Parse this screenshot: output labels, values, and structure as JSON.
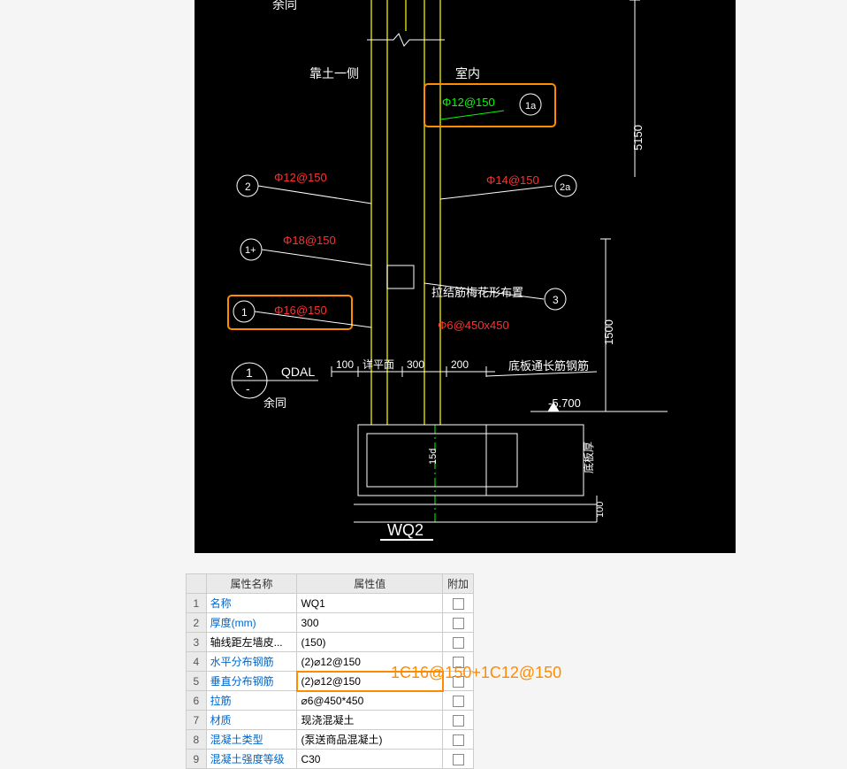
{
  "cad": {
    "title": "WQ2",
    "labels": {
      "outside": "靠土一侧",
      "inside": "室内",
      "tie_note": "拉结筋梅花形布置",
      "detail_plane": "详平面",
      "bottom_rebar": "底板通长筋钢筋",
      "ref_same": "余同",
      "thick_label": "底板厚",
      "ref_code": "QDAL"
    },
    "rebar": {
      "r12_150_top": "Φ12@150",
      "r12_150_left": "Φ12@150",
      "r14_150": "Φ14@150",
      "r18_150": "Φ18@150",
      "r16_150": "Φ16@150",
      "r6_450": "Φ6@450x450"
    },
    "dims": {
      "d5150": "5150",
      "d1500": "1500",
      "d100a": "100",
      "d300": "300",
      "d200": "200",
      "d100b": "100",
      "d15d": "15d",
      "elev": "-5.700"
    },
    "bubbles": {
      "b1": "1",
      "b1a": "1a",
      "b1plus": "1+",
      "b2": "2",
      "b2a": "2a",
      "b3": "3",
      "sec": "1"
    }
  },
  "table": {
    "header": {
      "name": "属性名称",
      "value": "属性值",
      "extra": "附加"
    },
    "rows": [
      {
        "n": "1",
        "name": "名称",
        "value": "WQ1",
        "link": true
      },
      {
        "n": "2",
        "name": "厚度(mm)",
        "value": "300",
        "link": true
      },
      {
        "n": "3",
        "name": "轴线距左墙皮...",
        "value": "(150)",
        "link": false
      },
      {
        "n": "4",
        "name": "水平分布钢筋",
        "value": "(2)⌀12@150",
        "link": true
      },
      {
        "n": "5",
        "name": "垂直分布钢筋",
        "value": "(2)⌀12@150",
        "link": true,
        "highlight": true
      },
      {
        "n": "6",
        "name": "拉筋",
        "value": "⌀6@450*450",
        "link": true
      },
      {
        "n": "7",
        "name": "材质",
        "value": "现浇混凝土",
        "link": true
      },
      {
        "n": "8",
        "name": "混凝土类型",
        "value": "(泵送商品混凝土)",
        "link": true
      },
      {
        "n": "9",
        "name": "混凝土强度等级",
        "value": "C30",
        "link": true
      }
    ]
  },
  "annotation": "1C16@150+1C12@150"
}
